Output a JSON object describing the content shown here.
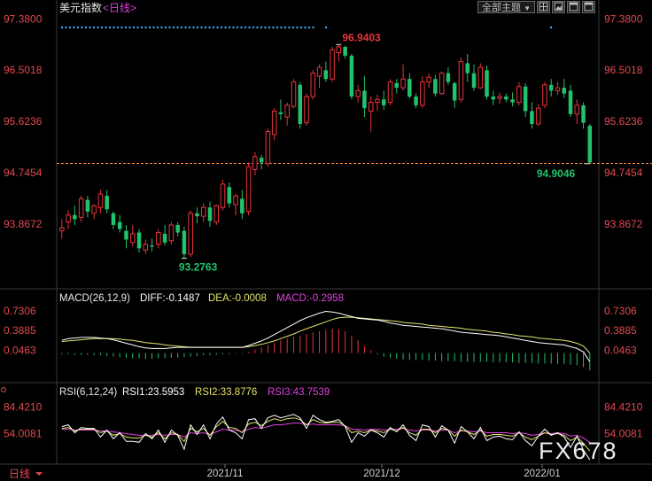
{
  "header": {
    "title": "美元指数",
    "period": "<日线>",
    "menu_label": "全部主题",
    "menu_arrow": "▼",
    "icons": [
      "grid-icon",
      "image-icon",
      "window-icon",
      "window-icon"
    ]
  },
  "watermark": "FX678",
  "bottom_label": "日线",
  "colors": {
    "up": "#e8343a",
    "down": "#21c26b",
    "axis_text": "#e34850",
    "dif_line": "#ffffff",
    "dea_line": "#e3e36b",
    "macd_line": "#e040e0",
    "rsi1": "#ffffff",
    "rsi2": "#e3e36b",
    "rsi3": "#e040e0",
    "last_price_line": "#ff8a3d",
    "dots": "#3fa9f5"
  },
  "price_panel": {
    "y_ticks": [
      "97.3800",
      "96.5018",
      "95.6236",
      "94.7454",
      "93.8672"
    ],
    "y_range": [
      93.0,
      97.4
    ],
    "high_label": "96.9403",
    "low_label": "93.2763",
    "last_label": "94.9046",
    "last_price": 94.9046
  },
  "macd_panel": {
    "title": "MACD(26,12,9)",
    "diff": "DIFF:-0.1487",
    "dea": "DEA:-0.0008",
    "macd": "MACD:-0.2958",
    "y_ticks": [
      "0.7306",
      "0.3885",
      "0.0463"
    ],
    "y_range": [
      -0.45,
      0.82
    ]
  },
  "rsi_panel": {
    "title": "RSI(6,12,24)",
    "rsi1": "RSI1:23.5953",
    "rsi2": "RSI2:33.8776",
    "rsi3": "RSI3:43.7539",
    "y_ticks": [
      "84.4210",
      "54.0081"
    ],
    "y_range": [
      20,
      92
    ]
  },
  "x_axis_labels": [
    "2021/11",
    "2021/12",
    "2022/01"
  ],
  "chart_data": {
    "type": "candlestick",
    "note_ohlc": "approximate daily OHLC values read from the chart",
    "candles": [
      [
        93.75,
        93.95,
        93.62,
        93.8
      ],
      [
        93.9,
        94.1,
        93.78,
        94.02
      ],
      [
        94.02,
        94.18,
        93.85,
        93.95
      ],
      [
        93.98,
        94.35,
        93.9,
        94.3
      ],
      [
        94.28,
        94.35,
        93.98,
        94.08
      ],
      [
        94.05,
        94.2,
        93.95,
        94.18
      ],
      [
        94.15,
        94.45,
        94.05,
        94.38
      ],
      [
        94.35,
        94.45,
        94.05,
        94.12
      ],
      [
        94.05,
        94.08,
        93.78,
        93.85
      ],
      [
        93.9,
        94.02,
        93.72,
        93.78
      ],
      [
        93.75,
        93.85,
        93.45,
        93.6
      ],
      [
        93.55,
        93.85,
        93.48,
        93.7
      ],
      [
        93.72,
        93.78,
        93.38,
        93.45
      ],
      [
        93.42,
        93.6,
        93.35,
        93.52
      ],
      [
        93.5,
        93.62,
        93.4,
        93.48
      ],
      [
        93.52,
        93.78,
        93.45,
        93.72
      ],
      [
        93.7,
        93.85,
        93.5,
        93.55
      ],
      [
        93.58,
        93.9,
        93.52,
        93.85
      ],
      [
        93.85,
        93.9,
        93.65,
        93.72
      ],
      [
        93.75,
        93.82,
        93.28,
        93.35
      ],
      [
        93.35,
        94.1,
        93.3,
        94.05
      ],
      [
        94.05,
        94.15,
        93.88,
        94.0
      ],
      [
        94.0,
        94.22,
        93.9,
        94.15
      ],
      [
        94.15,
        94.25,
        93.82,
        93.92
      ],
      [
        93.9,
        94.2,
        93.85,
        94.18
      ],
      [
        94.15,
        94.62,
        94.1,
        94.55
      ],
      [
        94.5,
        94.58,
        94.15,
        94.22
      ],
      [
        94.2,
        94.38,
        94.02,
        94.35
      ],
      [
        94.3,
        94.45,
        93.95,
        94.05
      ],
      [
        94.08,
        94.92,
        94.02,
        94.85
      ],
      [
        94.8,
        95.1,
        94.7,
        95.02
      ],
      [
        95.0,
        95.05,
        94.8,
        94.92
      ],
      [
        94.9,
        95.5,
        94.85,
        95.45
      ],
      [
        95.4,
        95.85,
        95.3,
        95.8
      ],
      [
        95.78,
        96.0,
        95.65,
        95.75
      ],
      [
        95.7,
        95.95,
        95.55,
        95.9
      ],
      [
        95.88,
        96.35,
        95.85,
        96.3
      ],
      [
        96.25,
        96.3,
        95.5,
        95.58
      ],
      [
        95.6,
        96.1,
        95.55,
        96.05
      ],
      [
        96.05,
        96.5,
        96.0,
        96.45
      ],
      [
        96.4,
        96.6,
        96.2,
        96.55
      ],
      [
        96.5,
        96.65,
        96.3,
        96.35
      ],
      [
        96.35,
        96.9,
        96.3,
        96.85
      ],
      [
        96.8,
        96.94,
        96.65,
        96.9
      ],
      [
        96.9,
        96.92,
        96.7,
        96.75
      ],
      [
        96.75,
        96.78,
        96.0,
        96.05
      ],
      [
        96.05,
        96.25,
        95.95,
        96.15
      ],
      [
        96.15,
        96.4,
        95.7,
        95.85
      ],
      [
        95.8,
        96.05,
        95.45,
        95.95
      ],
      [
        95.95,
        96.08,
        95.8,
        96.0
      ],
      [
        96.0,
        96.15,
        95.82,
        95.9
      ],
      [
        95.95,
        96.35,
        95.9,
        96.3
      ],
      [
        96.28,
        96.35,
        96.1,
        96.2
      ],
      [
        96.2,
        96.6,
        96.15,
        96.35
      ],
      [
        96.35,
        96.45,
        96.02,
        96.05
      ],
      [
        96.05,
        96.1,
        95.85,
        95.9
      ],
      [
        95.9,
        96.4,
        95.85,
        96.3
      ],
      [
        96.3,
        96.45,
        96.2,
        96.38
      ],
      [
        96.35,
        96.42,
        96.05,
        96.1
      ],
      [
        96.1,
        96.48,
        96.08,
        96.45
      ],
      [
        96.45,
        96.55,
        96.25,
        96.3
      ],
      [
        96.28,
        96.3,
        95.85,
        95.98
      ],
      [
        96.0,
        96.72,
        95.95,
        96.65
      ],
      [
        96.62,
        96.78,
        96.3,
        96.45
      ],
      [
        96.45,
        96.6,
        96.15,
        96.2
      ],
      [
        96.2,
        96.62,
        96.18,
        96.55
      ],
      [
        96.5,
        96.58,
        96.0,
        96.05
      ],
      [
        96.05,
        96.15,
        95.9,
        96.0
      ],
      [
        96.02,
        96.12,
        95.92,
        96.05
      ],
      [
        96.05,
        96.1,
        95.95,
        96.0
      ],
      [
        96.0,
        96.12,
        95.88,
        95.95
      ],
      [
        95.95,
        96.3,
        95.9,
        96.22
      ],
      [
        96.22,
        96.28,
        95.7,
        95.8
      ],
      [
        95.8,
        95.95,
        95.5,
        95.58
      ],
      [
        95.58,
        95.92,
        95.55,
        95.85
      ],
      [
        95.9,
        96.3,
        95.85,
        96.25
      ],
      [
        96.25,
        96.35,
        96.05,
        96.15
      ],
      [
        96.15,
        96.3,
        96.08,
        96.2
      ],
      [
        96.2,
        96.35,
        96.02,
        96.1
      ],
      [
        96.15,
        96.25,
        95.7,
        95.75
      ],
      [
        95.75,
        96.0,
        95.58,
        95.9
      ],
      [
        95.9,
        95.95,
        95.5,
        95.6
      ],
      [
        95.55,
        95.58,
        94.9,
        94.92
      ]
    ],
    "macd_hist": [
      -0.02,
      -0.02,
      -0.03,
      -0.03,
      -0.03,
      -0.04,
      -0.04,
      -0.05,
      -0.06,
      -0.07,
      -0.08,
      -0.09,
      -0.09,
      -0.1,
      -0.1,
      -0.09,
      -0.09,
      -0.08,
      -0.08,
      -0.07,
      -0.06,
      -0.05,
      -0.04,
      -0.04,
      -0.03,
      -0.02,
      -0.02,
      -0.01,
      -0.01,
      0.02,
      0.06,
      0.1,
      0.14,
      0.18,
      0.22,
      0.25,
      0.28,
      0.3,
      0.33,
      0.36,
      0.38,
      0.4,
      0.42,
      0.42,
      0.38,
      0.3,
      0.22,
      0.12,
      0.05,
      -0.02,
      -0.06,
      -0.08,
      -0.1,
      -0.11,
      -0.12,
      -0.12,
      -0.12,
      -0.13,
      -0.13,
      -0.14,
      -0.14,
      -0.14,
      -0.15,
      -0.15,
      -0.15,
      -0.15,
      -0.15,
      -0.16,
      -0.16,
      -0.16,
      -0.16,
      -0.17,
      -0.17,
      -0.17,
      -0.18,
      -0.18,
      -0.18,
      -0.19,
      -0.19,
      -0.2,
      -0.21,
      -0.24,
      -0.3
    ],
    "dif": [
      0.22,
      0.25,
      0.26,
      0.27,
      0.27,
      0.27,
      0.26,
      0.25,
      0.23,
      0.2,
      0.17,
      0.14,
      0.11,
      0.09,
      0.08,
      0.08,
      0.08,
      0.09,
      0.1,
      0.1,
      0.1,
      0.1,
      0.1,
      0.1,
      0.1,
      0.1,
      0.1,
      0.1,
      0.1,
      0.13,
      0.17,
      0.21,
      0.26,
      0.32,
      0.38,
      0.44,
      0.5,
      0.56,
      0.61,
      0.65,
      0.69,
      0.72,
      0.71,
      0.69,
      0.66,
      0.63,
      0.6,
      0.59,
      0.58,
      0.57,
      0.55,
      0.52,
      0.5,
      0.48,
      0.47,
      0.46,
      0.45,
      0.44,
      0.43,
      0.42,
      0.4,
      0.38,
      0.36,
      0.35,
      0.34,
      0.33,
      0.32,
      0.31,
      0.3,
      0.28,
      0.26,
      0.24,
      0.22,
      0.2,
      0.18,
      0.17,
      0.16,
      0.15,
      0.14,
      0.11,
      0.08,
      0.02,
      -0.15
    ],
    "dea": [
      0.2,
      0.21,
      0.22,
      0.23,
      0.24,
      0.25,
      0.25,
      0.25,
      0.25,
      0.24,
      0.23,
      0.22,
      0.2,
      0.18,
      0.17,
      0.16,
      0.14,
      0.13,
      0.12,
      0.11,
      0.1,
      0.1,
      0.1,
      0.1,
      0.1,
      0.1,
      0.1,
      0.1,
      0.1,
      0.11,
      0.13,
      0.15,
      0.18,
      0.21,
      0.25,
      0.29,
      0.33,
      0.38,
      0.42,
      0.46,
      0.5,
      0.54,
      0.58,
      0.61,
      0.62,
      0.62,
      0.61,
      0.6,
      0.59,
      0.58,
      0.57,
      0.56,
      0.55,
      0.53,
      0.52,
      0.51,
      0.5,
      0.48,
      0.47,
      0.46,
      0.45,
      0.44,
      0.43,
      0.41,
      0.4,
      0.39,
      0.38,
      0.36,
      0.35,
      0.33,
      0.32,
      0.3,
      0.29,
      0.28,
      0.26,
      0.25,
      0.24,
      0.23,
      0.22,
      0.2,
      0.17,
      0.12,
      0.0
    ],
    "rsi1": [
      62,
      64,
      55,
      61,
      60,
      60,
      50,
      58,
      48,
      55,
      45,
      45,
      44,
      54,
      48,
      58,
      44,
      58,
      52,
      36,
      64,
      53,
      64,
      48,
      65,
      73,
      58,
      55,
      48,
      70,
      71,
      60,
      72,
      75,
      72,
      74,
      76,
      72,
      60,
      75,
      70,
      67,
      68,
      70,
      62,
      44,
      55,
      51,
      58,
      55,
      50,
      61,
      56,
      64,
      52,
      46,
      64,
      62,
      50,
      63,
      58,
      43,
      62,
      56,
      48,
      61,
      46,
      50,
      51,
      48,
      47,
      56,
      46,
      40,
      51,
      59,
      52,
      55,
      50,
      38,
      51,
      35,
      24
    ],
    "rsi2": [
      60,
      61,
      57,
      59,
      59,
      59,
      55,
      57,
      52,
      54,
      50,
      49,
      49,
      52,
      50,
      55,
      48,
      55,
      53,
      45,
      60,
      56,
      60,
      52,
      62,
      68,
      61,
      60,
      55,
      65,
      67,
      63,
      68,
      71,
      69,
      71,
      72,
      70,
      64,
      70,
      67,
      66,
      67,
      67,
      63,
      55,
      57,
      55,
      58,
      57,
      55,
      59,
      57,
      61,
      55,
      52,
      59,
      59,
      55,
      60,
      58,
      51,
      58,
      56,
      53,
      58,
      51,
      53,
      53,
      52,
      51,
      55,
      50,
      47,
      51,
      55,
      53,
      54,
      52,
      46,
      50,
      43,
      34
    ],
    "rsi3": [
      59,
      59,
      58,
      58,
      58,
      58,
      57,
      57,
      56,
      55,
      54,
      53,
      52,
      52,
      52,
      53,
      52,
      53,
      53,
      50,
      55,
      54,
      55,
      53,
      56,
      59,
      58,
      58,
      56,
      59,
      61,
      60,
      62,
      64,
      64,
      65,
      66,
      66,
      64,
      65,
      64,
      64,
      64,
      64,
      63,
      59,
      59,
      58,
      59,
      59,
      58,
      59,
      59,
      60,
      58,
      57,
      58,
      58,
      57,
      58,
      58,
      55,
      57,
      57,
      56,
      57,
      55,
      55,
      55,
      55,
      54,
      55,
      54,
      52,
      53,
      55,
      54,
      55,
      54,
      51,
      52,
      49,
      44
    ],
    "xlabel": "",
    "ylabel": ""
  }
}
